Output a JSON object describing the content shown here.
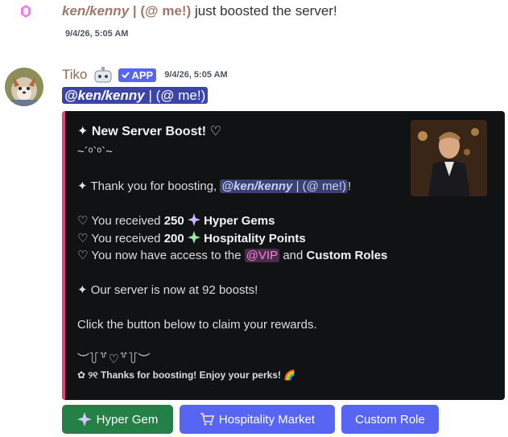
{
  "system_message": {
    "username": "ken/kenny",
    "username_suffix": "| (@ me!)",
    "text": "just boosted the server!",
    "timestamp": "9/4/26, 5:05 AM"
  },
  "message": {
    "author": "Tiko",
    "app_badge": "APP",
    "timestamp": "9/4/26, 5:05 AM",
    "mention_name": "@ken/kenny",
    "mention_suffix": "| (@ me!)"
  },
  "embed": {
    "accent_color": "#e33e7e",
    "title": "✦ New Server Boost! ♡",
    "subtitle": "~´ᵒ`ᵒ`~",
    "thank_prefix": "✦ Thank you for boosting,",
    "thank_mention": "@ken/kenny",
    "thank_mention_suffix": "| (@ me!)",
    "thank_suffix": "!",
    "received_prefix": "♡ You received",
    "gems_amount": "250",
    "gems_label": "Hyper Gems",
    "points_amount": "200",
    "points_label": "Hospitality Points",
    "access_prefix": "♡ You now have access to the",
    "access_role": "@VIP",
    "access_and": "and",
    "access_custom": "Custom Roles",
    "boost_count_text": "✦ Our server is now at 92 boosts!",
    "claim_text": "Click the button below to claim your rewards.",
    "divider": "︶꒦꒷♡꒷꒦︶",
    "footer": "✿ ୨୧ Thanks for boosting! Enjoy your perks! 🌈"
  },
  "buttons": {
    "hyper_gem": "Hyper Gem",
    "hospitality_market": "Hospitality Market",
    "custom_role": "Custom Role"
  },
  "icons": {
    "boost": "boost-gem-icon",
    "check": "check-icon",
    "sparkle": "sparkle-icon",
    "cart": "shopping-cart-icon"
  }
}
